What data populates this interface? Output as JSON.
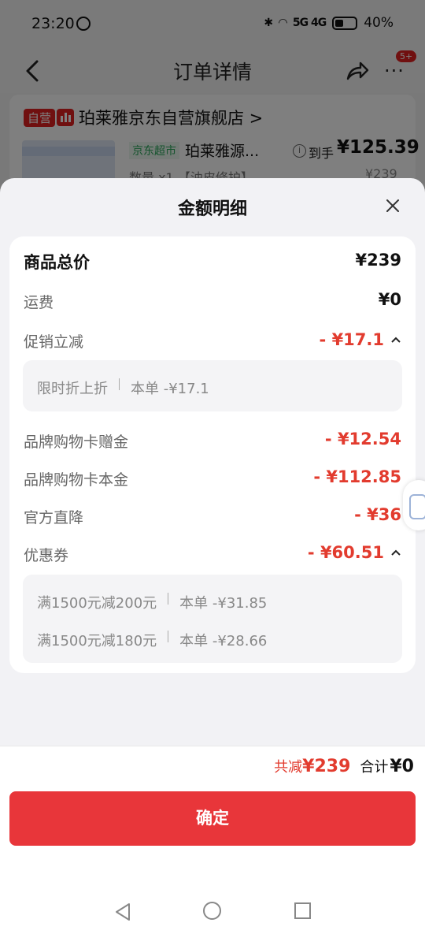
{
  "status_bar": {
    "time": "23:20",
    "network": "5G 4G",
    "battery": "40%"
  },
  "nav": {
    "title": "订单详情",
    "badge": "5+"
  },
  "shop": {
    "self_tag": "自营",
    "name": "珀莱雅京东自营旗舰店 >",
    "jd_tag": "京东超市",
    "product_name": "珀莱雅源...",
    "pay_label": "到手",
    "pay_value": "¥125.39",
    "qty": "数量 x1 【油皮修护】",
    "original_price": "¥239"
  },
  "sheet": {
    "title": "金额明细",
    "rows": {
      "goods_total": {
        "label": "商品总价",
        "value": "¥239"
      },
      "shipping": {
        "label": "运费",
        "value": "¥0"
      },
      "promo": {
        "label": "促销立减",
        "value": "- ¥17.1"
      },
      "brand_gift": {
        "label": "品牌购物卡赠金",
        "value": "- ¥12.54"
      },
      "brand_principal": {
        "label": "品牌购物卡本金",
        "value": "- ¥112.85"
      },
      "official": {
        "label": "官方直降",
        "value": "- ¥36"
      },
      "coupon": {
        "label": "优惠券",
        "value": "- ¥60.51"
      }
    },
    "promo_detail": [
      {
        "name": "限时折上折",
        "amount": "本单 -¥17.1"
      }
    ],
    "coupon_detail": [
      {
        "name": "满1500元减200元",
        "amount": "本单 -¥31.85"
      },
      {
        "name": "满1500元减180元",
        "amount": "本单 -¥28.66"
      }
    ]
  },
  "footer": {
    "reduce_label": "共减",
    "reduce_value": "¥239",
    "sum_label": "合计",
    "sum_value": "¥0",
    "confirm_label": "确定"
  },
  "colors": {
    "accent_red": "#e23b2e",
    "button_red": "#e8363a"
  }
}
